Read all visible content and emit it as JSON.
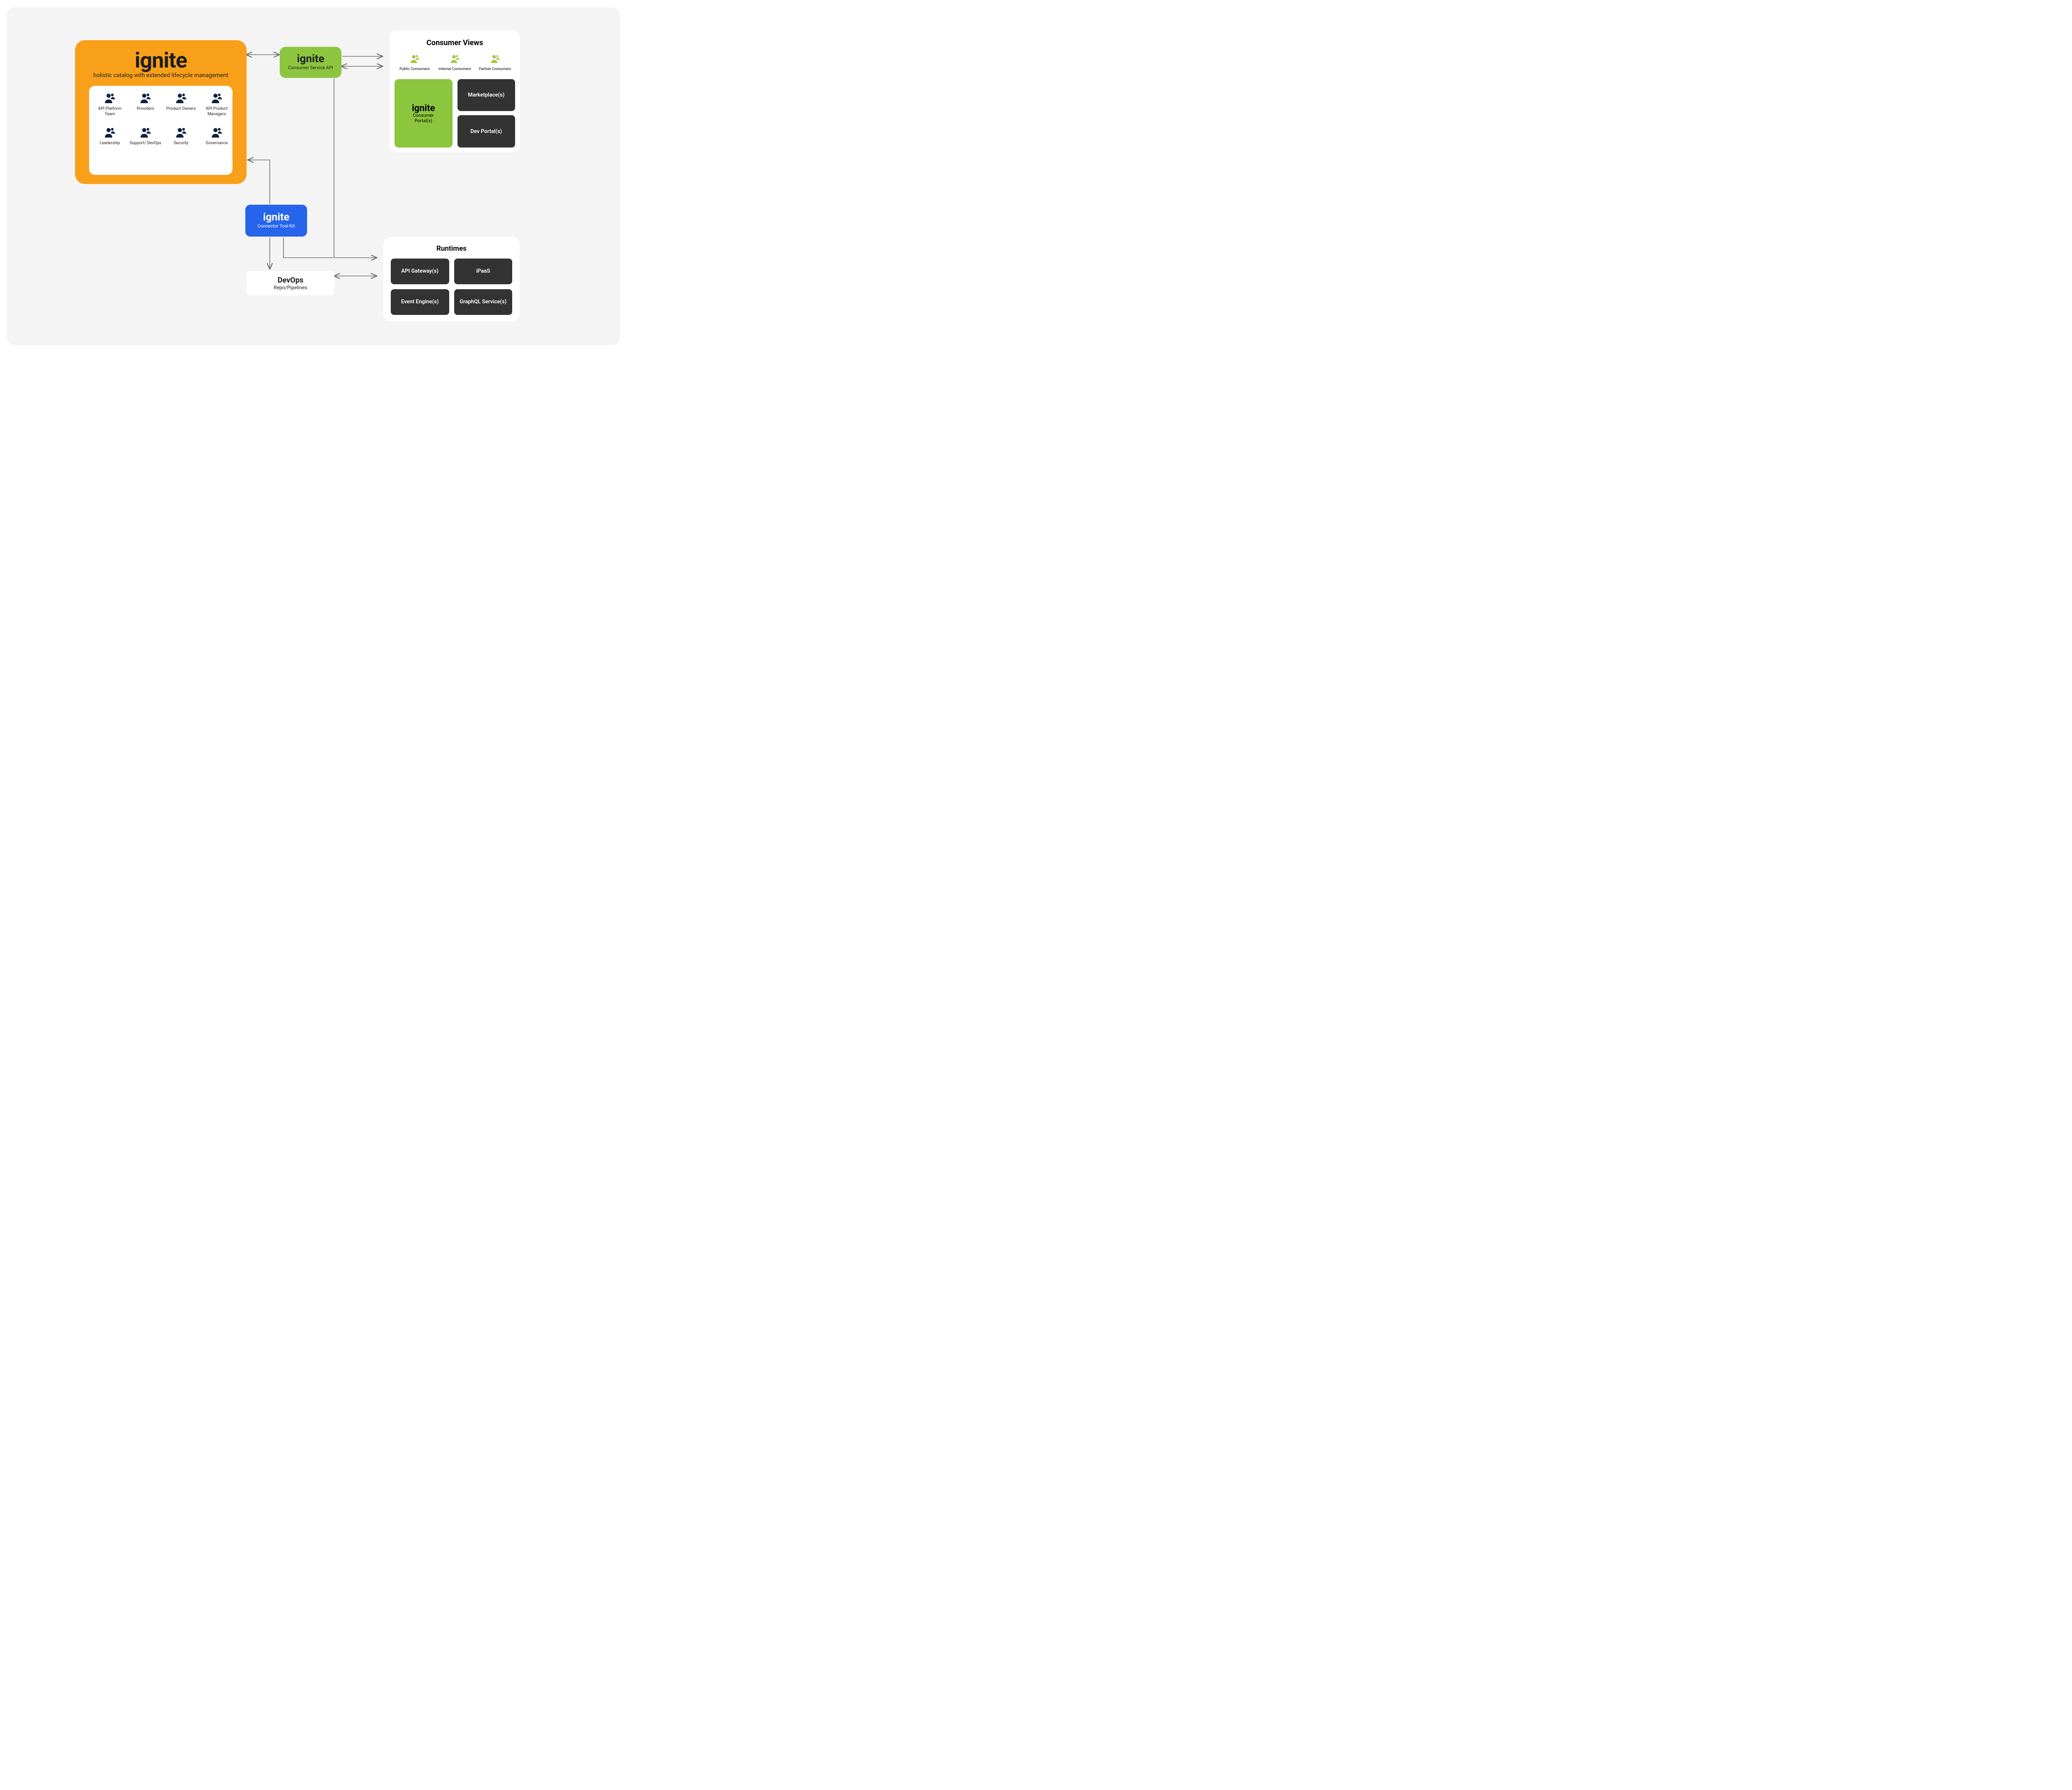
{
  "catalog": {
    "title": "ignite",
    "subtitle": "holistic catalog with extended lifecycle management",
    "personas": [
      "API Platform Team",
      "Providers",
      "Product Owners",
      "API Product Managers",
      "Leadership",
      "Support/ DevOps",
      "Security",
      "Governance"
    ]
  },
  "api_box": {
    "title": "ignite",
    "subtitle": "Consumer Service API"
  },
  "connector_box": {
    "title": "ignite",
    "subtitle": "Connector Tool Kit"
  },
  "devops_box": {
    "title": "DevOps",
    "subtitle": "Repo/Pipelines"
  },
  "consumer_views": {
    "title": "Consumer Views",
    "consumers": [
      "Public Consumers",
      "Internal Consumers",
      "Partner Consumers"
    ],
    "portal": {
      "title": "ignite",
      "line2": "Consumer",
      "line3": "Portal(s)"
    },
    "tiles": [
      "Marketplace(s)",
      "Dev Portal(s)"
    ]
  },
  "runtimes": {
    "title": "Runtimes",
    "tiles": [
      "API Gateway(s)",
      "iPaaS",
      "Event Engine(s)",
      "GraphQL Service(s)"
    ]
  },
  "colors": {
    "orange": "#f9a01b",
    "green": "#8cc63f",
    "blue": "#2664eb",
    "dark": "#333333",
    "arrow": "#6f6f6f",
    "persona_icon": "#0b2340",
    "consumer_icon": "#a6c63f"
  }
}
